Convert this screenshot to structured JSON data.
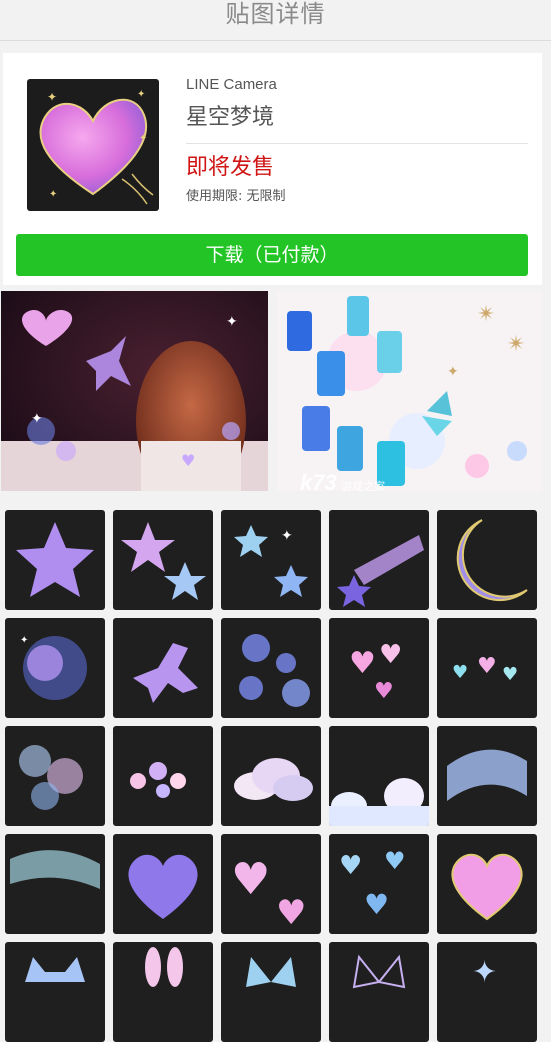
{
  "header": {
    "title": "贴图详情"
  },
  "product": {
    "brand": "LINE Camera",
    "name": "星空梦境",
    "status": "即将发售",
    "limit": "使用期限: 无限制",
    "download_label": "下载（已付款）"
  },
  "watermark": {
    "main": "k73",
    "sub": "游戏之家"
  },
  "colors": {
    "accent_green": "#22c525",
    "status_red": "#d01515"
  },
  "stickers": [
    "galaxy-star",
    "two-stars",
    "twinkle-stars",
    "shooting-star",
    "crescent-moon",
    "nebula-cloud",
    "pegasus",
    "bubbles",
    "pink-hearts-bokeh",
    "hearts-sparkles",
    "bokeh-lights",
    "bokeh-cluster",
    "cloud-pink",
    "cloud-border",
    "aurora-wave",
    "aurora-sky",
    "galaxy-heart",
    "two-hearts",
    "blue-hearts",
    "pink-heart-glitter",
    "cat",
    "bunny-ears",
    "butterfly",
    "butterfly-outline",
    "sparkle"
  ]
}
